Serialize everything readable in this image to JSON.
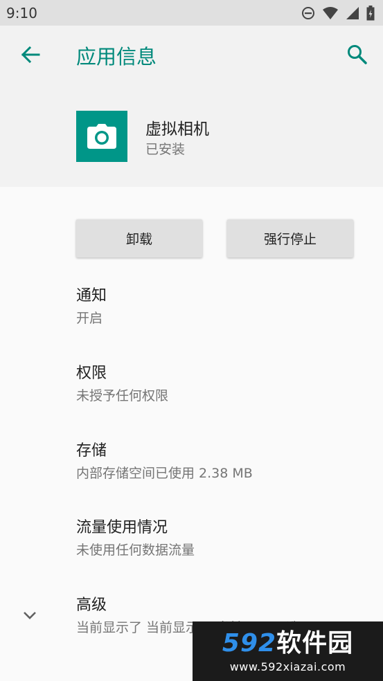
{
  "status_bar": {
    "time": "9:10",
    "icons": [
      "do-not-disturb-icon",
      "wifi-icon",
      "signal-icon",
      "battery-icon"
    ]
  },
  "toolbar": {
    "title": "应用信息",
    "back_icon": "arrow-back-icon",
    "search_icon": "search-icon"
  },
  "app": {
    "name": "虚拟相机",
    "status": "已安装",
    "icon": "camera-icon",
    "icon_color": "#009688"
  },
  "buttons": {
    "uninstall": "卸载",
    "force_stop": "强行停止"
  },
  "rows": [
    {
      "title": "通知",
      "subtitle": "开启"
    },
    {
      "title": "权限",
      "subtitle": "未授予任何权限"
    },
    {
      "title": "存储",
      "subtitle": "内部存储空间已使用 2.38 MB"
    },
    {
      "title": "流量使用情况",
      "subtitle": "未使用任何数据流量"
    },
    {
      "title": "高级",
      "subtitle": "当前显示了 当前显示了 当前显示了 选项"
    }
  ],
  "watermark": {
    "logo_num": "592",
    "logo_text": "软件园",
    "url": "www.592xiazai.com"
  },
  "colors": {
    "accent": "#00897b",
    "status_bar_bg": "#e0e0e0",
    "header_bg": "#f2f2f2",
    "button_bg": "#e0e0e0"
  }
}
